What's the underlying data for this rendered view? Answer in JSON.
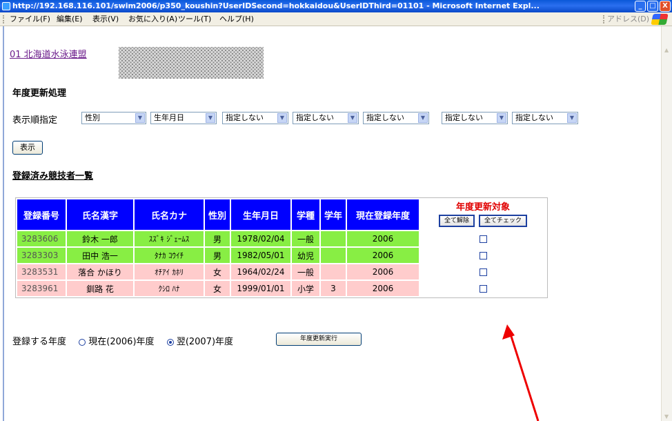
{
  "window": {
    "title": "http://192.168.116.101/swim2006/p350_koushin?UserIDSecond=hokkaidou&UserIDThird=01101 - Microsoft Internet Expl...",
    "min_label": "_",
    "max_label": "□",
    "close_label": "X"
  },
  "menu": {
    "file": "ファイル(F)",
    "edit": "編集(E)",
    "view": "表示(V)",
    "favorites": "お気に入り(A)",
    "tools": "ツール(T)",
    "help": "ヘルプ(H)",
    "address": "アドレス(D)"
  },
  "org_link": "01 北海道水泳連盟",
  "section_title": "年度更新処理",
  "sort": {
    "label": "表示順指定",
    "selects": [
      "性別",
      "生年月日",
      "指定しない",
      "指定しない",
      "指定しない",
      "指定しない",
      "指定しない"
    ]
  },
  "display_button": "表示",
  "list_title": "登録済み競技者一覧",
  "table": {
    "headers": [
      "登録番号",
      "氏名漢字",
      "氏名カナ",
      "性別",
      "生年月日",
      "学種",
      "学年",
      "現在登録年度"
    ],
    "target_header": "年度更新対象",
    "uncheck_all": "全て解除",
    "check_all": "全てチェック",
    "rows": [
      {
        "id": "3283606",
        "kanji": "鈴木 一郎",
        "kana": "ｽｽﾞｷ ｼﾞｪｰﾑｽ",
        "sex": "男",
        "birth": "1978/02/04",
        "school_type": "一般",
        "grade": "",
        "year": "2006",
        "color": "green"
      },
      {
        "id": "3283303",
        "kanji": "田中 浩一",
        "kana": "ﾀﾅｶ ｺｳｲﾁ",
        "sex": "男",
        "birth": "1982/05/01",
        "school_type": "幼児",
        "grade": "",
        "year": "2006",
        "color": "green"
      },
      {
        "id": "3283531",
        "kanji": "落合 かほり",
        "kana": "ｵﾁｱｲ ｶﾎﾘ",
        "sex": "女",
        "birth": "1964/02/24",
        "school_type": "一般",
        "grade": "",
        "year": "2006",
        "color": "pink"
      },
      {
        "id": "3283961",
        "kanji": "釧路 花",
        "kana": "ｸｼﾛ ﾊﾅ",
        "sex": "女",
        "birth": "1999/01/01",
        "school_type": "小学",
        "grade": "3",
        "year": "2006",
        "color": "pink"
      }
    ]
  },
  "year_form": {
    "label": "登録する年度",
    "current": "現在(2006)年度",
    "next": "翌(2007)年度",
    "selected": "next",
    "execute_button": "年度更新実行"
  },
  "colors": {
    "header_blue": "#0000ff",
    "row_green": "#88ee44",
    "row_pink": "#ffcccc",
    "target_red": "#e00000",
    "arrow_red": "#ee0000"
  }
}
